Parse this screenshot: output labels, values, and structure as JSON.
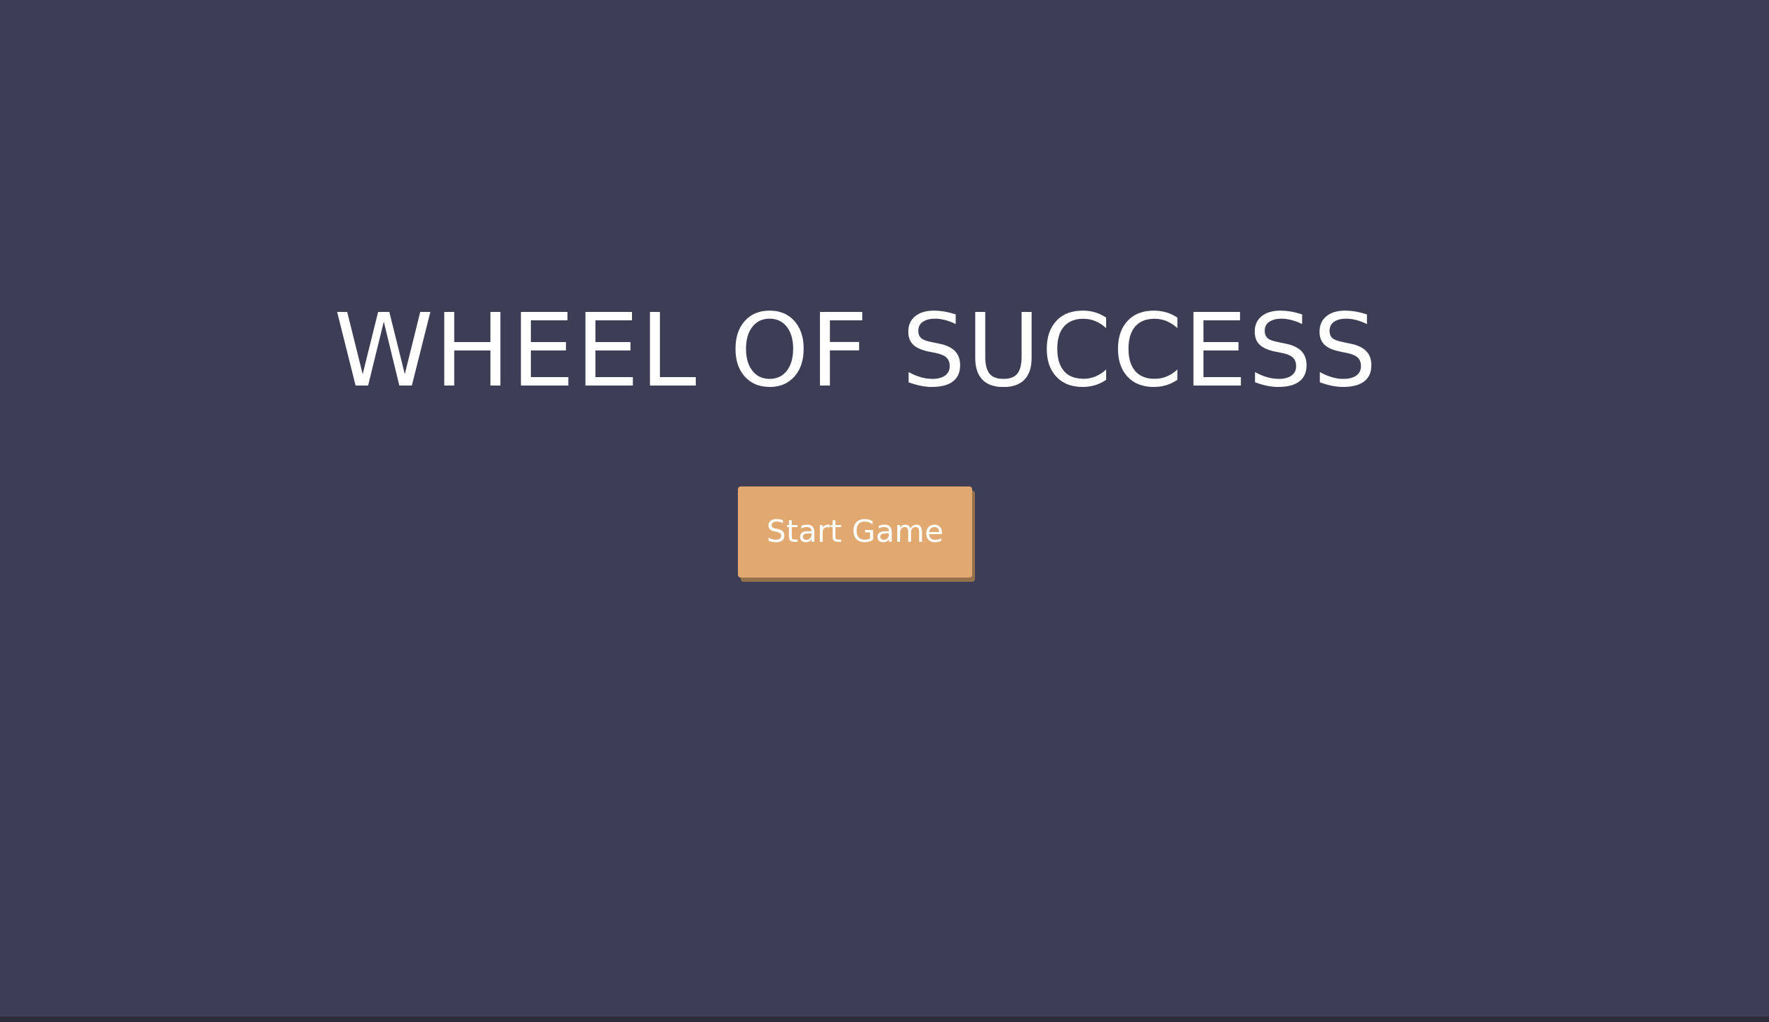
{
  "game": {
    "title": "WHEEL OF SUCCESS",
    "start_button_label": "Start Game"
  },
  "colors": {
    "background": "#3d3d55",
    "title_text": "#ffffff",
    "button_fill": "#e1a86f",
    "button_shadow": "#94714d",
    "button_text": "#ffffff"
  }
}
